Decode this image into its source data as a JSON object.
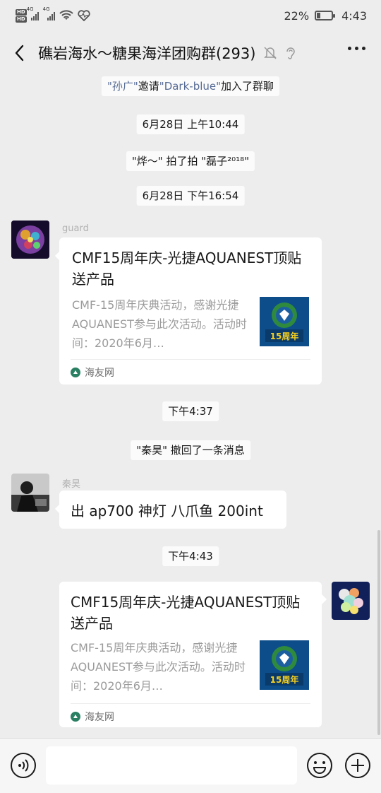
{
  "status_bar": {
    "hd1": "HD",
    "hd2": "HD",
    "net1": "4G",
    "net2": "4G",
    "battery_percent": "22%",
    "time": "4:43"
  },
  "header": {
    "title": "礁岩海水～糖果海洋团购群(293)"
  },
  "messages": {
    "join_notice": {
      "inviter": "\"孙广\"",
      "verb": "邀请",
      "invitee": "\"Dark-blue\"",
      "suffix": "加入了群聊"
    },
    "time1": "6月28日 上午10:44",
    "pat_notice": "\"烨～\" 拍了拍 \"磊子²⁰¹⁸\"",
    "time2": "6月28日 下午16:54",
    "card1": {
      "sender": "guard",
      "title": "CMF15周年庆-光捷AQUANEST顶贴送产品",
      "description": "CMF-15周年庆典活动，感谢光捷AQUANEST参与此次活动。活动时间：2020年6月…",
      "thumb_caption": "15周年",
      "source": "海友网"
    },
    "time3": "下午4:37",
    "recall_notice": "\"秦昊\" 撤回了一条消息",
    "text_msg": {
      "sender": "秦昊",
      "text": "出 ap700 神灯  八爪鱼 200int"
    },
    "time4": "下午4:43",
    "card2": {
      "title": "CMF15周年庆-光捷AQUANEST顶贴送产品",
      "description": "CMF-15周年庆典活动，感谢光捷AQUANEST参与此次活动。活动时间：2020年6月…",
      "thumb_caption": "15周年",
      "source": "海友网"
    }
  },
  "input_bar": {
    "placeholder": ""
  },
  "colors": {
    "background": "#ededed",
    "link_name": "#576b95",
    "bubble": "#ffffff"
  },
  "icons": [
    "back-arrow-icon",
    "mute-bell-icon",
    "earpiece-icon",
    "more-dots-icon",
    "voice-icon",
    "emoji-icon",
    "plus-icon",
    "wifi-icon",
    "heart-icon"
  ]
}
